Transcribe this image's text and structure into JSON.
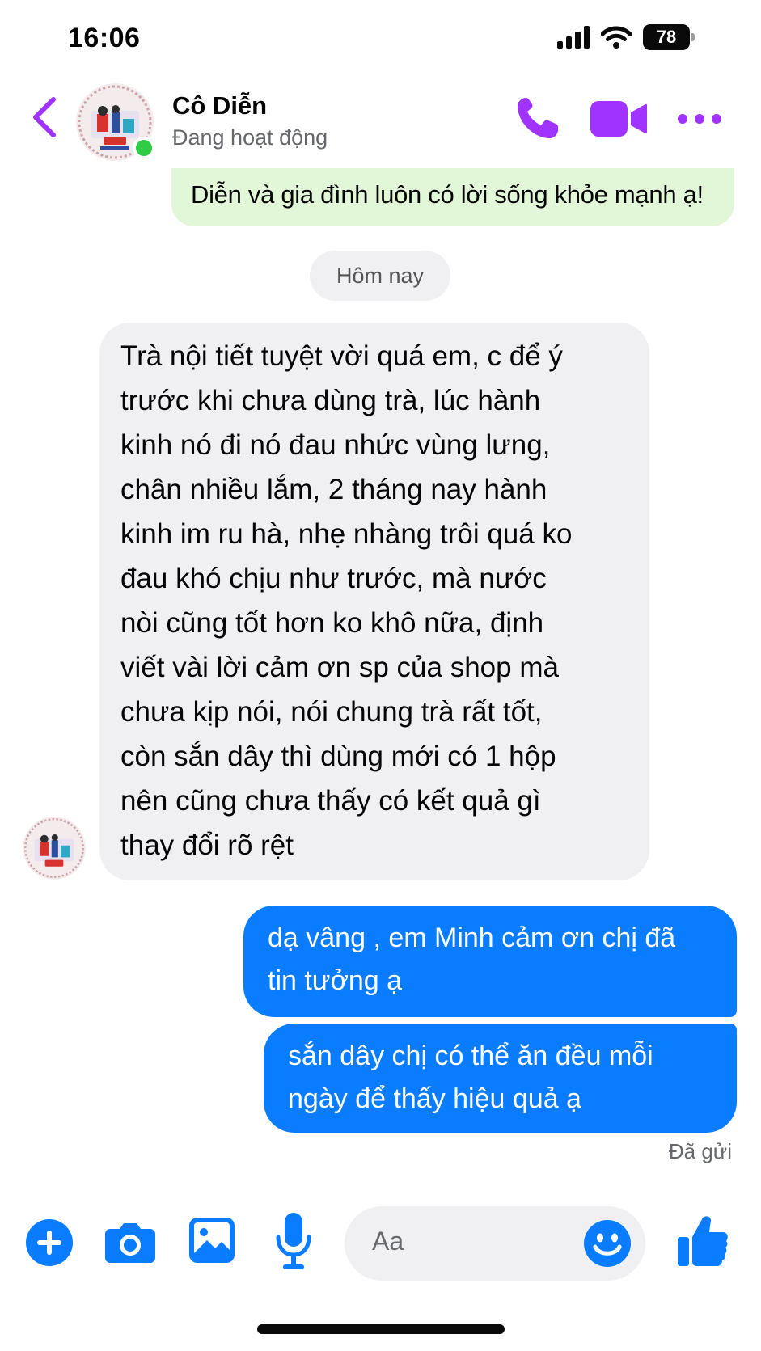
{
  "status_bar": {
    "time": "16:06",
    "battery": "78"
  },
  "header": {
    "contact_name": "Cô Diễn",
    "contact_status": "Đang hoạt động"
  },
  "colors": {
    "accent": "#a033ff",
    "brand_blue": "#0a7cff",
    "online": "#31cc46",
    "bubble_gray": "#f0f0f2",
    "bubble_green": "#e2f7d8"
  },
  "messages": [
    {
      "sender": "me",
      "lines": [
        "Diễn và gia đình luôn có lời sống khỏe mạnh ạ!"
      ]
    },
    {
      "type": "date_divider",
      "text": "Hôm nay"
    },
    {
      "sender": "them",
      "lines": [
        "Trà nội tiết tuyệt vời quá em, c để ý",
        "trước khi chưa dùng trà, lúc hành",
        "kinh nó đi nó đau nhức vùng lưng,",
        "chân nhiều lắm, 2 tháng nay hành",
        "kinh im ru hà, nhẹ nhàng trôi quá ko",
        "đau khó chịu như trước, mà nước",
        "nòi cũng tốt hơn ko khô nữa, định",
        "viết vài lời cảm ơn sp của shop mà",
        "chưa kịp nói, nói chung trà rất tốt,",
        "còn sắn dây thì dùng mới có 1 hộp",
        "nên cũng chưa thấy có kết quả gì",
        "thay đổi rõ rệt"
      ]
    },
    {
      "sender": "me",
      "lines": [
        "dạ vâng , em Minh cảm ơn chị đã",
        "tin tưởng ạ"
      ]
    },
    {
      "sender": "me",
      "lines": [
        "sắn dây chị có thể ăn đều mỗi",
        "ngày để thấy hiệu quả ạ"
      ]
    }
  ],
  "sent_status": "Đã gửi",
  "composer": {
    "placeholder": "Aa",
    "icons": [
      "plus-icon",
      "camera-icon",
      "image-icon",
      "microphone-icon",
      "emoji-icon",
      "thumbs-up-icon"
    ]
  }
}
